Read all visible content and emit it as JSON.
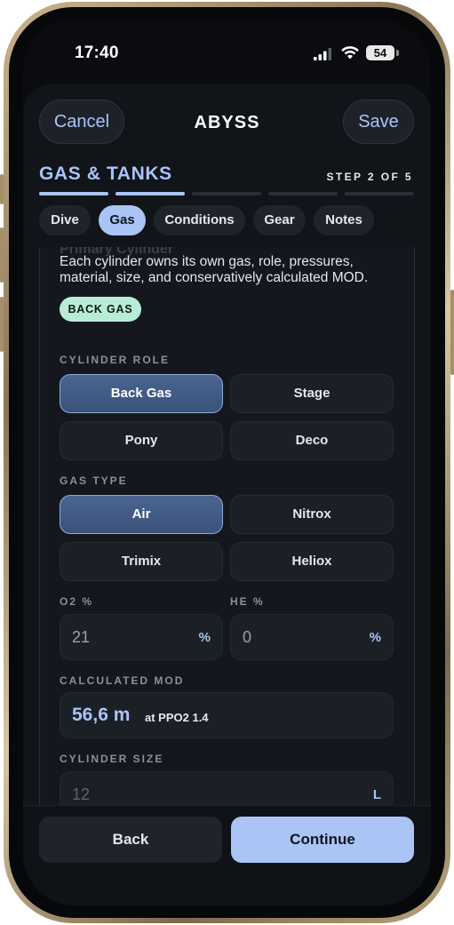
{
  "status_bar": {
    "time": "17:40",
    "battery": "54"
  },
  "header": {
    "cancel_label": "Cancel",
    "title": "ABYSS",
    "save_label": "Save"
  },
  "wizard": {
    "section_title": "GAS & TANKS",
    "step_label": "STEP 2 OF 5",
    "progress": {
      "current": 2,
      "total": 5
    }
  },
  "tabs": [
    {
      "label": "Dive",
      "active": false
    },
    {
      "label": "Gas",
      "active": true
    },
    {
      "label": "Conditions",
      "active": false
    },
    {
      "label": "Gear",
      "active": false
    },
    {
      "label": "Notes",
      "active": false
    }
  ],
  "content": {
    "faded_heading": "Primary Cylinder",
    "description": "Each cylinder owns its own gas, role, pressures, material, size, and conservatively calculated MOD.",
    "badge": "BACK GAS",
    "cylinder_role": {
      "label": "CYLINDER ROLE",
      "options": [
        "Back Gas",
        "Stage",
        "Pony",
        "Deco"
      ],
      "selected": "Back Gas"
    },
    "gas_type": {
      "label": "GAS TYPE",
      "options": [
        "Air",
        "Nitrox",
        "Trimix",
        "Heliox"
      ],
      "selected": "Air"
    },
    "o2": {
      "label": "O2 %",
      "value": "21",
      "unit": "%"
    },
    "he": {
      "label": "HE %",
      "value": "0",
      "unit": "%"
    },
    "mod": {
      "label": "CALCULATED MOD",
      "value": "56,6 m",
      "note": "at PPO2 1.4"
    },
    "cylinder_size": {
      "label": "CYLINDER SIZE",
      "value": "12",
      "unit": "L"
    }
  },
  "footer": {
    "back_label": "Back",
    "continue_label": "Continue"
  },
  "colors": {
    "accent": "#a9c4f5",
    "badge": "#b8ecd6",
    "selected_option": "#3a5279",
    "background": "#111419"
  }
}
